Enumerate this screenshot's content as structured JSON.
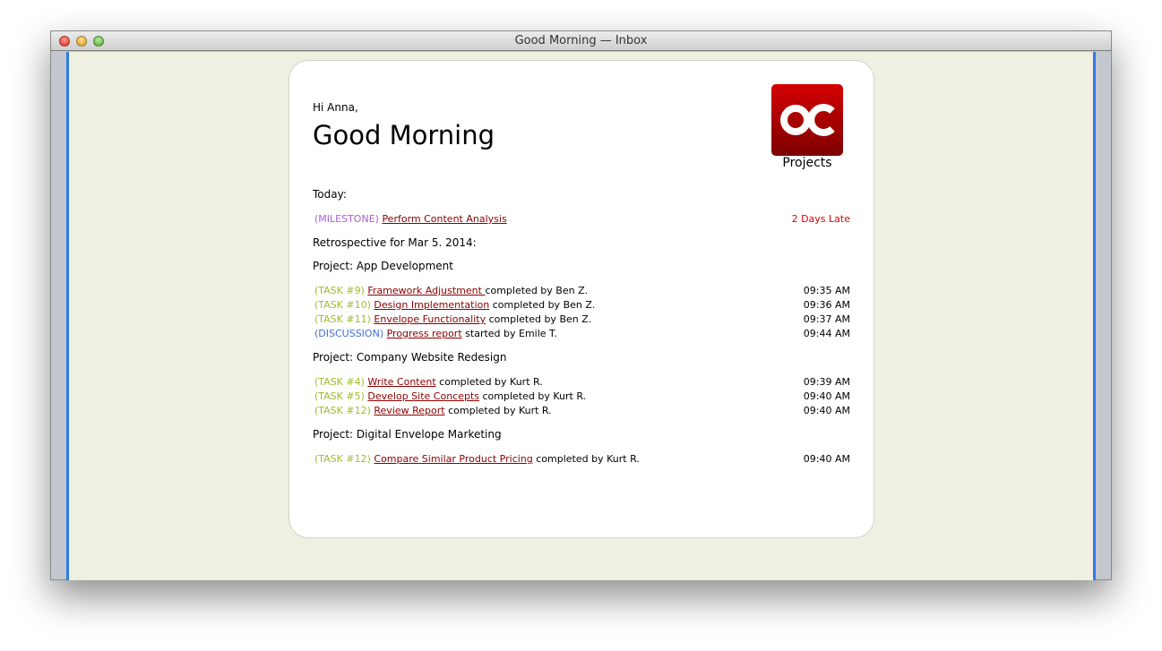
{
  "window": {
    "title": "Good Morning — Inbox"
  },
  "greeting": {
    "hi": "Hi Anna,",
    "headline": "Good Morning"
  },
  "logo": {
    "label": "Projects",
    "brand_color": "#c00000"
  },
  "today": {
    "label": "Today:",
    "items": [
      {
        "tag": "(MILESTONE)",
        "link": "Perform Content Analysis",
        "status": "2 Days Late"
      }
    ]
  },
  "retrospective": {
    "label": "Retrospective for Mar 5. 2014:",
    "projects": [
      {
        "title": "Project: App Development",
        "items": [
          {
            "tag": "(TASK #9)",
            "type": "task",
            "link": "Framework Adjustment ",
            "rest": "completed by Ben Z.",
            "time": "09:35 AM"
          },
          {
            "tag": "(TASK #10)",
            "type": "task",
            "link": "Design Implementation",
            "rest": " completed by Ben Z.",
            "time": "09:36 AM"
          },
          {
            "tag": "(TASK #11)",
            "type": "task",
            "link": "Envelope Functionality",
            "rest": " completed by Ben Z.",
            "time": "09:37 AM"
          },
          {
            "tag": "(DISCUSSION)",
            "type": "discussion",
            "link": "Progress report",
            "rest": " started by Emile T.",
            "time": "09:44 AM"
          }
        ]
      },
      {
        "title": "Project: Company Website Redesign",
        "items": [
          {
            "tag": "(TASK #4)",
            "type": "task",
            "link": "Write Content",
            "rest": " completed by Kurt R.",
            "time": "09:39 AM"
          },
          {
            "tag": "(TASK #5)",
            "type": "task",
            "link": "Develop Site Concepts",
            "rest": " completed by Kurt R.",
            "time": "09:40 AM"
          },
          {
            "tag": "(TASK #12)",
            "type": "task",
            "link": "Review Report",
            "rest": " completed by Kurt R.",
            "time": "09:40 AM"
          }
        ]
      },
      {
        "title": "Project: Digital Envelope Marketing",
        "items": [
          {
            "tag": "(TASK #12)",
            "type": "task",
            "link": "Compare Similar Product Pricing",
            "rest": " completed by Kurt R.",
            "time": "09:40 AM"
          }
        ]
      }
    ]
  }
}
